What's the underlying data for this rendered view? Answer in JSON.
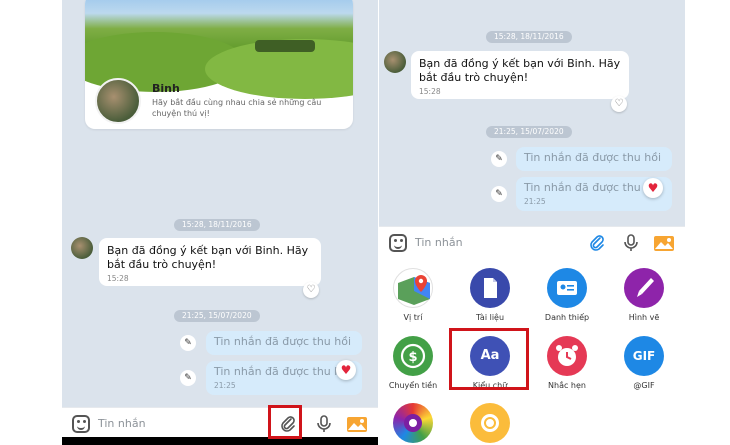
{
  "left": {
    "card": {
      "name": "Binh",
      "description": "Hãy bắt đầu cùng nhau chia sẻ những câu chuyện thú vị!"
    },
    "time1": "15:28, 18/11/2016",
    "incoming": {
      "text": "Bạn đã đồng ý kết bạn với Binh. Hãy bắt đầu trò chuyện!",
      "time": "15:28"
    },
    "time2": "21:25, 15/07/2020",
    "recalled1": "Tin nhắn đã được thu hồi",
    "recalled2": "Tin nhắn đã được thu hồi",
    "recalled2_time": "21:25",
    "input_placeholder": "Tin nhắn"
  },
  "right": {
    "time1": "15:28, 18/11/2016",
    "incoming": {
      "text": "Bạn đã đồng ý kết bạn với Binh. Hãy bắt đầu trò chuyện!",
      "time": "15:28"
    },
    "time2": "21:25, 15/07/2020",
    "recalled1": "Tin nhắn đã được thu hồi",
    "recalled2": "Tin nhắn đã được thu hồi",
    "recalled2_time": "21:25",
    "input_placeholder": "Tin nhắn",
    "features": [
      {
        "label": "Vị trí",
        "icon": "map-pin-icon"
      },
      {
        "label": "Tài liệu",
        "icon": "document-icon"
      },
      {
        "label": "Danh thiếp",
        "icon": "contact-card-icon"
      },
      {
        "label": "Hình vẽ",
        "icon": "brush-icon"
      },
      {
        "label": "Chuyển tiền",
        "icon": "money-transfer-icon"
      },
      {
        "label": "Kiểu chữ",
        "icon": "font-style-icon",
        "glyph": "Aa"
      },
      {
        "label": "Nhắc hẹn",
        "icon": "alarm-clock-icon"
      },
      {
        "label": "@GIF",
        "icon": "gif-icon",
        "glyph": "GIF"
      }
    ]
  },
  "colors": {
    "chat_background": "#dbe3ec",
    "highlight_red": "#d0141a",
    "heart_red": "#e3243b",
    "accent_blue": "#1e88e5"
  }
}
